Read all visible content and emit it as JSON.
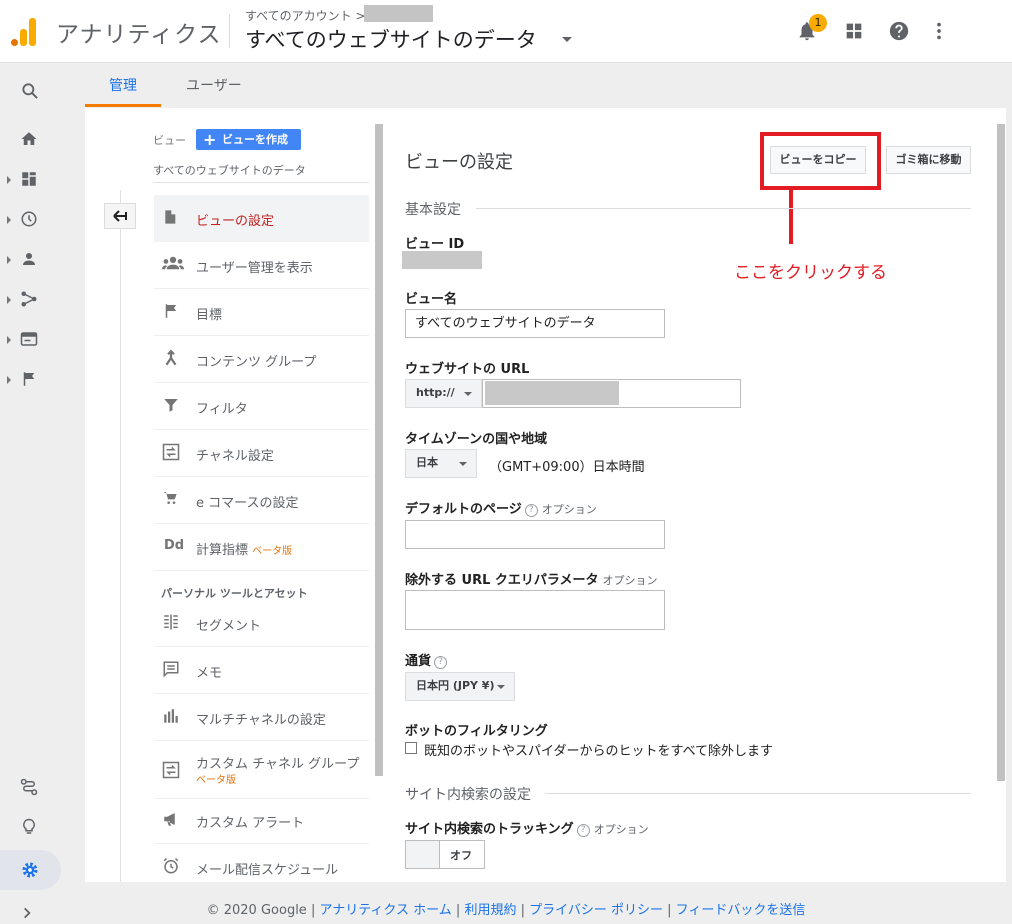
{
  "header": {
    "app_name": "アナリティクス",
    "account_crumb": "すべてのアカウント >",
    "property_title": "すべてのウェブサイトのデータ",
    "notification_count": "1"
  },
  "tabs": {
    "admin": "管理",
    "user": "ユーザー"
  },
  "view_panel": {
    "view_label": "ビュー",
    "create_button": "ビューを作成",
    "view_name": "すべてのウェブサイトのデータ"
  },
  "nav": {
    "items": [
      {
        "label": "ビューの設定"
      },
      {
        "label": "ユーザー管理を表示"
      },
      {
        "label": "目標"
      },
      {
        "label": "コンテンツ グループ"
      },
      {
        "label": "フィルタ"
      },
      {
        "label": "チャネル設定"
      },
      {
        "label": "e コマースの設定"
      },
      {
        "label": "計算指標",
        "beta": "ベータ版"
      }
    ],
    "section_title": "パーソナル ツールとアセット",
    "tools": [
      {
        "label": "セグメント"
      },
      {
        "label": "メモ"
      },
      {
        "label": "マルチチャネルの設定"
      },
      {
        "label": "カスタム チャネル グループ",
        "beta": "ベータ版"
      },
      {
        "label": "カスタム アラート"
      },
      {
        "label": "メール配信スケジュール"
      }
    ]
  },
  "settings": {
    "title": "ビューの設定",
    "copy_button": "ビューをコピー",
    "trash_button": "ゴミ箱に移動",
    "annotation": "ここをクリックする",
    "basic_header": "基本設定",
    "view_id_label": "ビュー ID",
    "view_name_label": "ビュー名",
    "view_name_value": "すべてのウェブサイトのデータ",
    "url_label": "ウェブサイトの URL",
    "protocol": "http://",
    "timezone_label": "タイムゾーンの国や地域",
    "country": "日本",
    "timezone_value": "（GMT+09:00）日本時間",
    "default_page_label": "デフォルトのページ",
    "exclude_params_label": "除外する URL クエリパラメータ",
    "optional": "オプション",
    "currency_label": "通貨",
    "currency_value": "日本円 (JPY ¥)",
    "bot_label": "ボットのフィルタリング",
    "bot_checkbox": "既知のボットやスパイダーからのヒットをすべて除外します",
    "site_search_header": "サイト内検索の設定",
    "site_search_label": "サイト内検索のトラッキング",
    "toggle_off": "オフ"
  },
  "footer": {
    "copyright": "© 2020 Google",
    "links": [
      "アナリティクス ホーム",
      "利用規約",
      "プライバシー ポリシー",
      "フィードバックを送信"
    ]
  },
  "colors": {
    "accent": "#1a73e8",
    "annotation": "#e31b23",
    "tab_underline": "#f57c00",
    "active_nav": "#c5221f"
  }
}
